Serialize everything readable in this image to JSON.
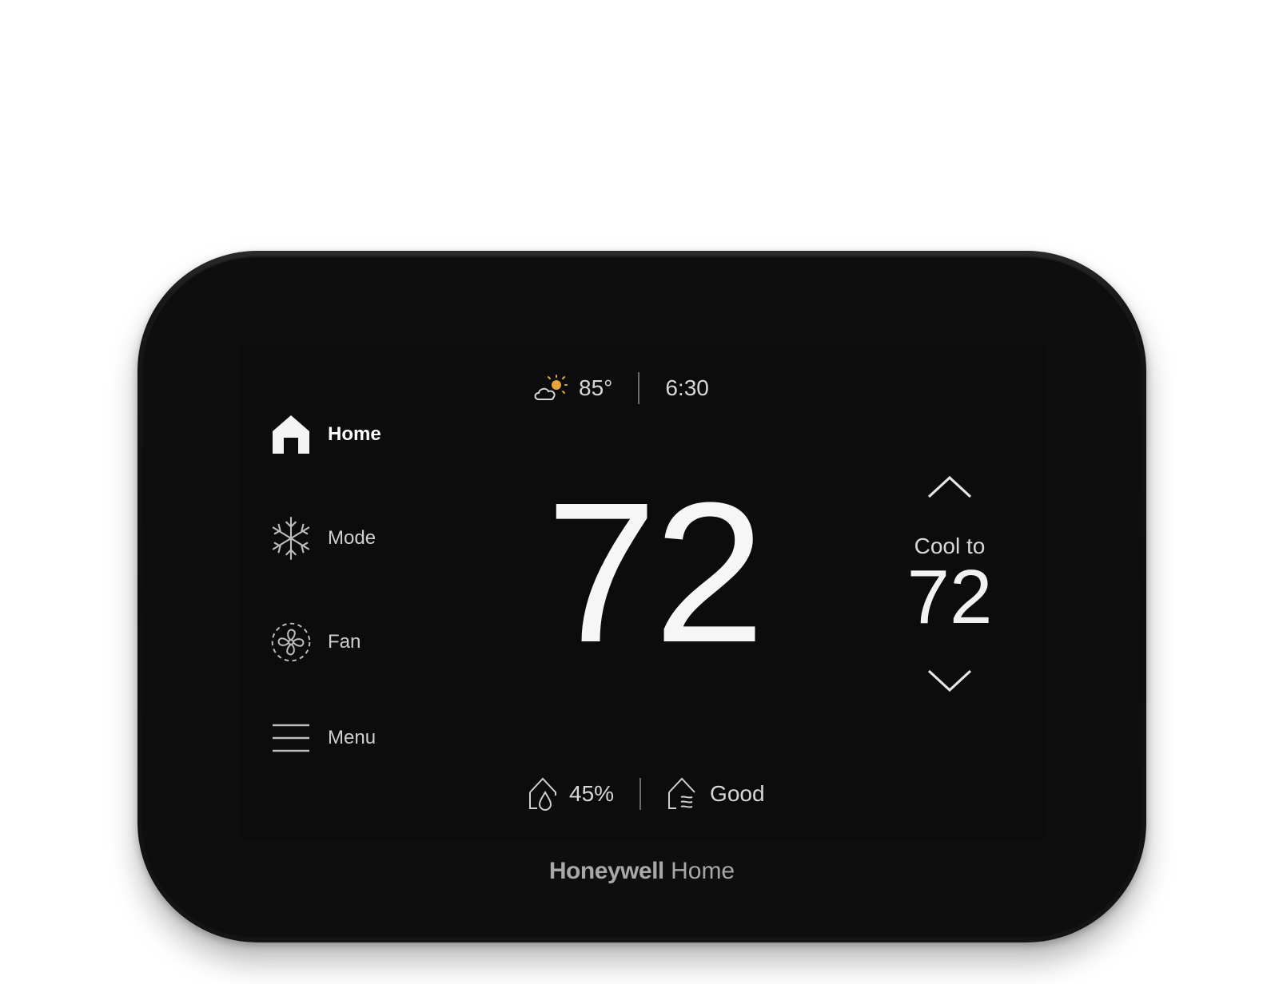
{
  "weather": {
    "icon": "partly-sunny-icon",
    "temperature": "85°"
  },
  "clock": {
    "time": "6:30"
  },
  "sidebar": {
    "items": [
      {
        "label": "Home",
        "icon": "home-icon"
      },
      {
        "label": "Mode",
        "icon": "snowflake-icon"
      },
      {
        "label": "Fan",
        "icon": "fan-icon"
      },
      {
        "label": "Menu",
        "icon": "hamburger-menu-icon"
      }
    ]
  },
  "current": {
    "temperature": "72"
  },
  "setpoint": {
    "label": "Cool to",
    "value": "72"
  },
  "humidity": {
    "icon": "humidity-drop-icon",
    "value": "45%"
  },
  "air_quality": {
    "icon": "air-quality-icon",
    "value": "Good"
  },
  "brand": {
    "bold": "Honeywell",
    "regular": "Home"
  },
  "colors": {
    "screen": "#0c0c0c",
    "text": "#f6f6f6",
    "accent_sun": "#e8a33a"
  }
}
